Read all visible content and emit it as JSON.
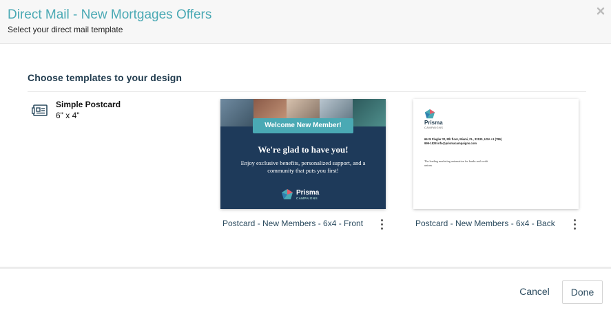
{
  "dialog": {
    "title": "Direct Mail - New Mortgages Offers",
    "subtitle": "Select your direct mail template",
    "close_icon": "close-icon"
  },
  "section": {
    "heading": "Choose templates to your design"
  },
  "template_types": [
    {
      "name": "Simple Postcard",
      "size": "6\" x 4\"",
      "icon": "postcard-icon"
    }
  ],
  "templates": [
    {
      "label": "Postcard - New Members - 6x4 - Front",
      "preview": {
        "banner": "Welcome New Member!",
        "headline": "We're glad to have you!",
        "body": "Enjoy exclusive benefits, personalized support, and a community that puts you first!",
        "logo_word": "Prisma",
        "logo_sub": "CAMPAIGNS"
      }
    },
    {
      "label": "Postcard - New Members - 6x4 - Back",
      "preview": {
        "logo_word": "Prisma",
        "logo_sub": "CAMPAIGNS",
        "address": "66 W Flagler St, 9th floor, Miami, FL, 33130, USA +1 (786) 999-1828 info@prismacampaigns.com",
        "tagline": "The leading marketing automation for banks and credit unions"
      }
    }
  ],
  "footer": {
    "cancel_label": "Cancel",
    "done_label": "Done"
  },
  "colors": {
    "title": "#4aa9b4",
    "accent": "#4aa9b4",
    "card_navy": "#1e3a5a",
    "text_dark": "#2a4a5e"
  }
}
